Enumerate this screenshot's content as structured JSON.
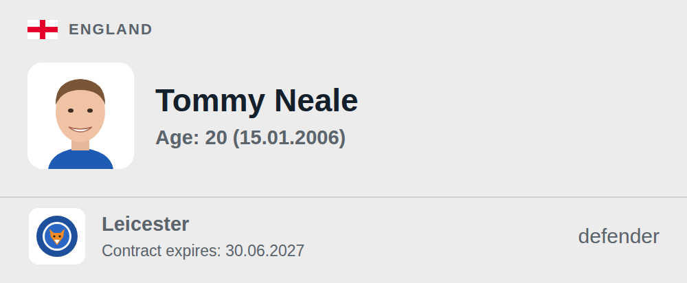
{
  "country": {
    "name": "ENGLAND"
  },
  "player": {
    "name": "Tommy Neale",
    "age": "Age: 20 (15.01.2006)"
  },
  "club": {
    "name": "Leicester",
    "contract": "Contract expires: 30.06.2027",
    "position": "defender"
  }
}
